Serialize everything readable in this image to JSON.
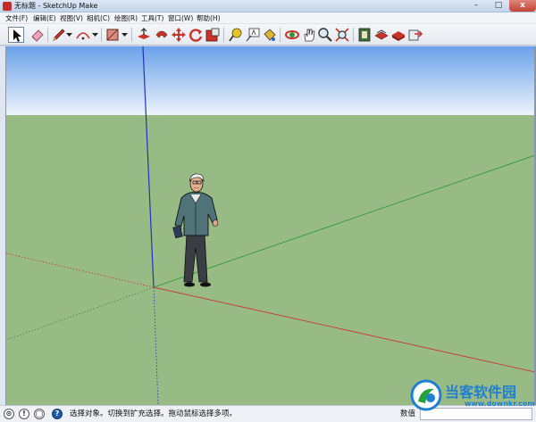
{
  "window": {
    "title": "无标题 - SketchUp Make",
    "caption_buttons": {
      "minimize": "–",
      "maximize": "□",
      "close": "x"
    }
  },
  "menu": {
    "items": [
      "文件(F)",
      "编辑(E)",
      "视图(V)",
      "相机(C)",
      "绘图(R)",
      "工具(T)",
      "窗口(W)",
      "帮助(H)"
    ]
  },
  "toolbar": {
    "tools": [
      "select-tool-icon",
      "eraser-tool-icon",
      "pencil-line-tool-icon",
      "arc-tool-icon",
      "rectangle-tool-icon",
      "push-pull-tool-icon",
      "follow-me-tool-icon",
      "move-tool-icon",
      "rotate-tool-icon",
      "scale-tool-icon",
      "tape-measure-tool-icon",
      "text-tool-icon",
      "paint-bucket-tool-icon",
      "orbit-tool-icon",
      "pan-tool-icon",
      "zoom-tool-icon",
      "zoom-extents-tool-icon",
      "warehouse-icon",
      "extension-warehouse-icon",
      "share-model-icon",
      "layout-send-icon"
    ]
  },
  "scene": {
    "sky_color": "#6aa1ea",
    "horizon_color": "#eef4fb",
    "ground_color": "#98bb86",
    "axis_colors": {
      "x": "#c83a30",
      "y": "#2f9a35",
      "z": "#2234b4"
    },
    "figure": "person-figure"
  },
  "status": {
    "icons": [
      "geo-location-icon",
      "credits-icon",
      "account-icon",
      "help-icon"
    ],
    "hint": "选择对象。切换到扩充选择。拖动鼠标选择多项。",
    "measurements_label": "数值",
    "measurements_value": ""
  },
  "watermark": {
    "title": "当客软件园",
    "url": "www.downkr.com"
  }
}
